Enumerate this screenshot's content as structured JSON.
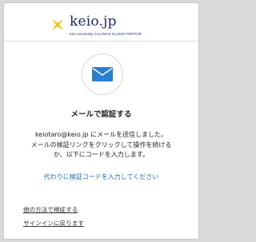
{
  "header": {
    "logo_name": "keio.jp",
    "logo_tagline": "Keio University CALAMVS GLADIO FORTIOR",
    "logo_colors": {
      "mark": "#f3c200",
      "text": "#1a2a6c"
    }
  },
  "main": {
    "icon": "mail-icon",
    "title": "メールで認証する",
    "message_lines": [
      "keiotaro@keio.jp にメールを送信しました。",
      "メールの検証リンクをクリックして操作を続ける",
      "か、以下にコードを入力します。"
    ],
    "enter_code_link": "代わりに検証コードを入力してください"
  },
  "footer": {
    "other_method_link": "他の方法で検証する",
    "back_to_signin_link": "サインインに戻ります"
  },
  "colors": {
    "accent": "#1a6fb8",
    "mail_icon": "#2b7fd1"
  }
}
